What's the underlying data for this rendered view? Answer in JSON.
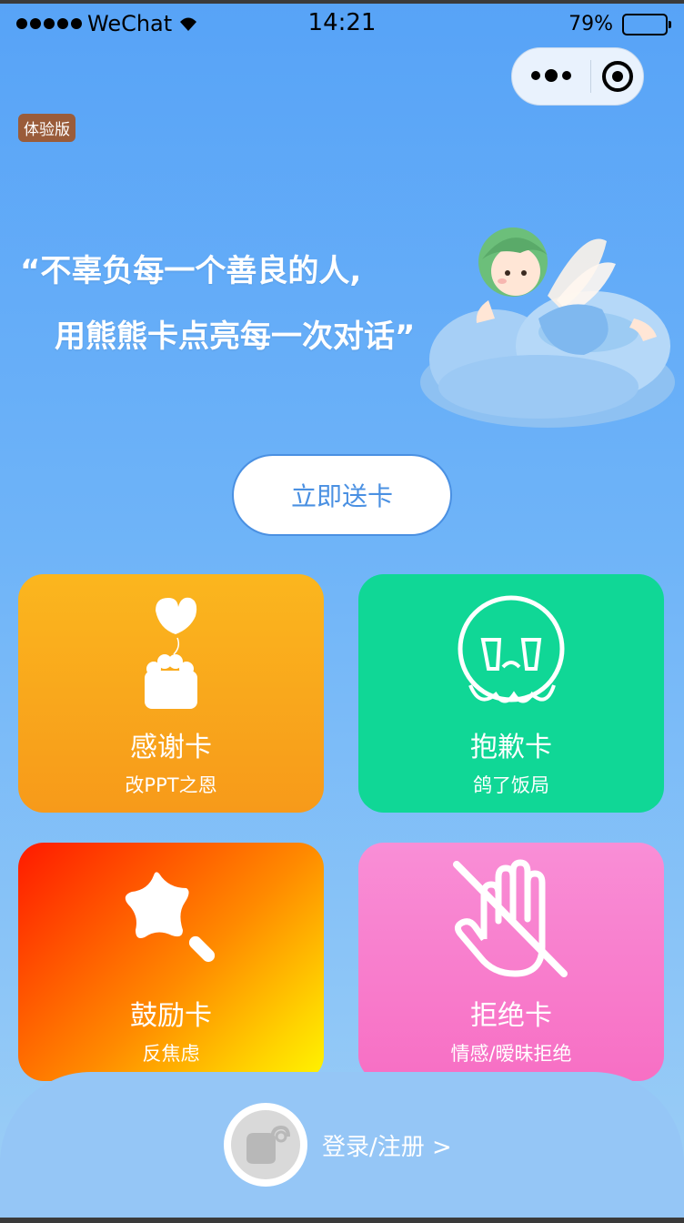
{
  "status_bar": {
    "carrier": "WeChat",
    "time": "14:21",
    "battery_percent": "79%",
    "battery_level": 0.79
  },
  "header": {
    "badge": "体验版",
    "more_icon": "more-dots-icon",
    "close_icon": "target-icon"
  },
  "hero": {
    "quote_line1": "“不辜负每一个善良的人,",
    "quote_line2": "用熊熊卡点亮每一次对话”"
  },
  "send_button": "立即送卡",
  "cards": [
    {
      "title": "感谢卡",
      "subtitle": "改PPT之恩",
      "icon": "heart-paw-icon",
      "color": "#fbb61e"
    },
    {
      "title": "抱歉卡",
      "subtitle": "鸽了饭局",
      "icon": "crying-face-icon",
      "color": "#10d796"
    },
    {
      "title": "鼓励卡",
      "subtitle": "反焦虑",
      "icon": "star-wand-icon",
      "color": "#ff5a00"
    },
    {
      "title": "拒绝卡",
      "subtitle": "情感/暧昧拒绝",
      "icon": "hand-no-icon",
      "color": "#f77fcc"
    }
  ],
  "login": {
    "label": "登录/注册 >"
  }
}
